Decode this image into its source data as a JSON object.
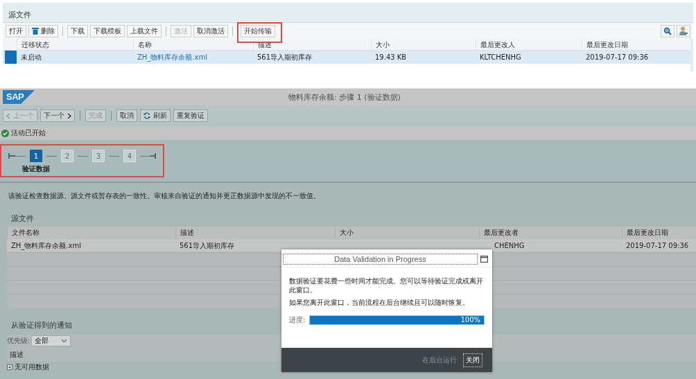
{
  "top_panel": {
    "title": "源文件",
    "toolbar_groups": [
      [
        {
          "label": "打开",
          "kind": "button",
          "disabled": false,
          "highlighted": false
        },
        {
          "label": "删除",
          "kind": "delete",
          "disabled": false,
          "highlighted": false
        }
      ],
      [
        {
          "label": "下载",
          "kind": "button",
          "disabled": false,
          "highlighted": false
        },
        {
          "label": "下载模板",
          "kind": "button",
          "disabled": false,
          "highlighted": false
        },
        {
          "label": "上载文件",
          "kind": "button",
          "disabled": false,
          "highlighted": false
        }
      ],
      [
        {
          "label": "激活",
          "kind": "button",
          "disabled": true,
          "highlighted": false
        },
        {
          "label": "取消激活",
          "kind": "button",
          "disabled": false,
          "highlighted": false
        }
      ],
      [
        {
          "label": "开始传输",
          "kind": "button",
          "disabled": false,
          "highlighted": true
        }
      ]
    ],
    "table": {
      "columns": [
        "迁移状态",
        "名称",
        "描述",
        "大小",
        "最后更改人",
        "最后更改日期"
      ],
      "rows": [
        {
          "selected": true,
          "cells": [
            "未启动",
            "ZH_物料库存余额.xml",
            "561导入期初库存",
            "19.43 KB",
            "KLTCHENHG",
            "2019-07-17 09:36"
          ]
        }
      ]
    }
  },
  "sap_window": {
    "logo": "SAP",
    "title": "物料库存余额: 步骤 1 (验证数据)",
    "toolbar_groups": [
      [
        {
          "label": "上一个",
          "kind": "prev",
          "disabled": true
        },
        {
          "label": "下一个",
          "kind": "next",
          "disabled": false
        }
      ],
      [
        {
          "label": "完成",
          "kind": "button",
          "disabled": true
        }
      ],
      [
        {
          "label": "取消",
          "kind": "button",
          "disabled": false
        },
        {
          "label": "刷新",
          "kind": "refresh",
          "disabled": false
        },
        {
          "label": "重复验证",
          "kind": "button",
          "disabled": false
        }
      ]
    ],
    "status_message": "活动已开始",
    "steps_highlighted": true,
    "steps": [
      {
        "number": "1",
        "label": "验证数据",
        "selected": true
      },
      {
        "number": "2",
        "selected": false
      },
      {
        "number": "3",
        "selected": false
      },
      {
        "number": "4",
        "selected": false
      }
    ],
    "description": "该验证检查数据源、源文件或暂存表的一致性。审核来自验证的通知并更正数据源中发现的不一致值。",
    "source_section": {
      "title": "源文件",
      "columns": [
        "文件名称",
        "描述",
        "大小",
        "最后更改者",
        "最后更改日期"
      ],
      "rows": [
        {
          "cells": [
            "ZH_物料库存余额.xml",
            "561导入期初库存",
            "",
            "CHENHG",
            "2019-07-17 09:36"
          ]
        }
      ]
    },
    "notifications": {
      "title": "从验证得到的通知",
      "priority_label": "优先级:",
      "priority_value": "全部",
      "columns": [
        "描述"
      ],
      "rows": [
        {
          "text": "无可用数据"
        }
      ]
    }
  },
  "dialog": {
    "title": "Data Validation in Progress",
    "lines": [
      "数据验证要花费一些时间才能完成。您可以等待验证完成或离开此窗口。",
      "如果您离开此窗口，当前流程在后台继续且可以随时恢复。"
    ],
    "progress_label": "进度:",
    "level": 1,
    "reading": "100%",
    "buttons": [
      {
        "label": "在后台运行",
        "kind": "text"
      },
      {
        "label": "关闭",
        "kind": "focused"
      }
    ]
  }
}
